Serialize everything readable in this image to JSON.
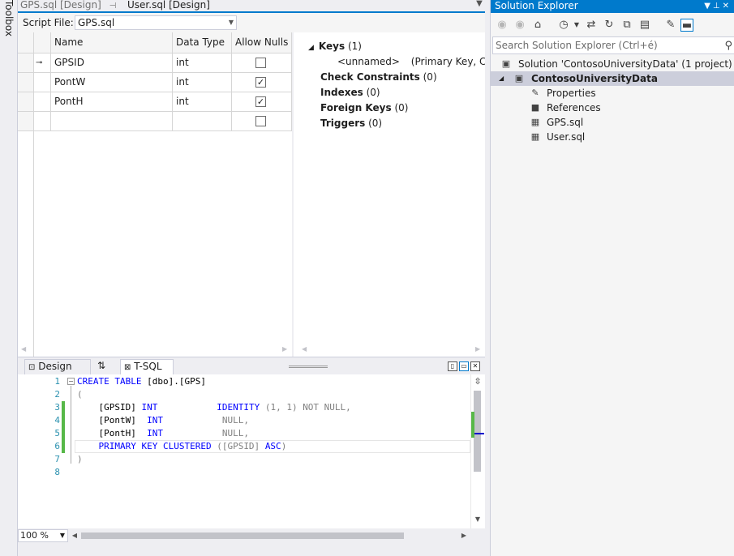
{
  "toolbox": {
    "label": "Toolbox"
  },
  "doc_tabs": [
    {
      "label": "GPS.sql [Design]",
      "pin": "⊣"
    },
    {
      "label": "User.sql [Design]"
    }
  ],
  "designer": {
    "script_file_label": "Script File:",
    "script_file_value": "GPS.sql",
    "grid": {
      "headers": [
        "Name",
        "Data Type",
        "Allow Nulls"
      ],
      "rows": [
        {
          "name": "GPSID",
          "type": "int",
          "allow_nulls": false,
          "key": true
        },
        {
          "name": "PontW",
          "type": "int",
          "allow_nulls": true,
          "key": false
        },
        {
          "name": "PontH",
          "type": "int",
          "allow_nulls": true,
          "key": false
        },
        {
          "name": "",
          "type": "",
          "allow_nulls": false,
          "key": false
        }
      ]
    },
    "props": {
      "keys_label": "Keys",
      "keys_count": "(1)",
      "key_item_name": "<unnamed>",
      "key_item_desc": "(Primary Key, Clustered: GPSID)",
      "check_label": "Check Constraints",
      "check_count": "(0)",
      "indexes_label": "Indexes",
      "indexes_count": "(0)",
      "fk_label": "Foreign Keys",
      "fk_count": "(0)",
      "triggers_label": "Triggers",
      "triggers_count": "(0)"
    }
  },
  "pane_tabs": {
    "design": "Design",
    "swap": "⇅",
    "tsql": "T-SQL"
  },
  "editor": {
    "line_numbers": [
      "1",
      "2",
      "3",
      "4",
      "5",
      "6",
      "7",
      "8"
    ],
    "code": {
      "l1_kw": "CREATE TABLE",
      "l1_rest": " [dbo].[GPS]",
      "l2": "(",
      "l3_a": "    [GPSID] ",
      "l3_kw": "INT",
      "l3_b": "           ",
      "l3_kw2": "IDENTITY",
      "l3_c": " (1, 1) ",
      "l3_gr": "NOT NULL",
      "l3_d": ",",
      "l4_a": "    [PontW]  ",
      "l4_kw": "INT",
      "l4_b": "           ",
      "l4_gr": "NULL",
      "l4_d": ",",
      "l5_a": "    [PontH]  ",
      "l5_kw": "INT",
      "l5_b": "           ",
      "l5_gr": "NULL",
      "l5_d": ",",
      "l6_a": "    ",
      "l6_kw": "PRIMARY KEY CLUSTERED",
      "l6_b": " ([GPSID] ",
      "l6_kw2": "ASC",
      "l6_c": ")",
      "l7": ")"
    }
  },
  "zoom": {
    "value": "100 %"
  },
  "solution_explorer": {
    "title": "Solution Explorer",
    "search_placeholder": "Search Solution Explorer (Ctrl+é)",
    "tree": [
      {
        "label": "Solution 'ContosoUniversityData' (1 project)"
      },
      {
        "label": "ContosoUniversityData"
      },
      {
        "label": "Properties"
      },
      {
        "label": "References"
      },
      {
        "label": "GPS.sql"
      },
      {
        "label": "User.sql"
      }
    ]
  },
  "colors": {
    "accent": "#007acc",
    "keyword": "#0000ff",
    "line_number": "#2b91af",
    "change_bar": "#57b848"
  }
}
